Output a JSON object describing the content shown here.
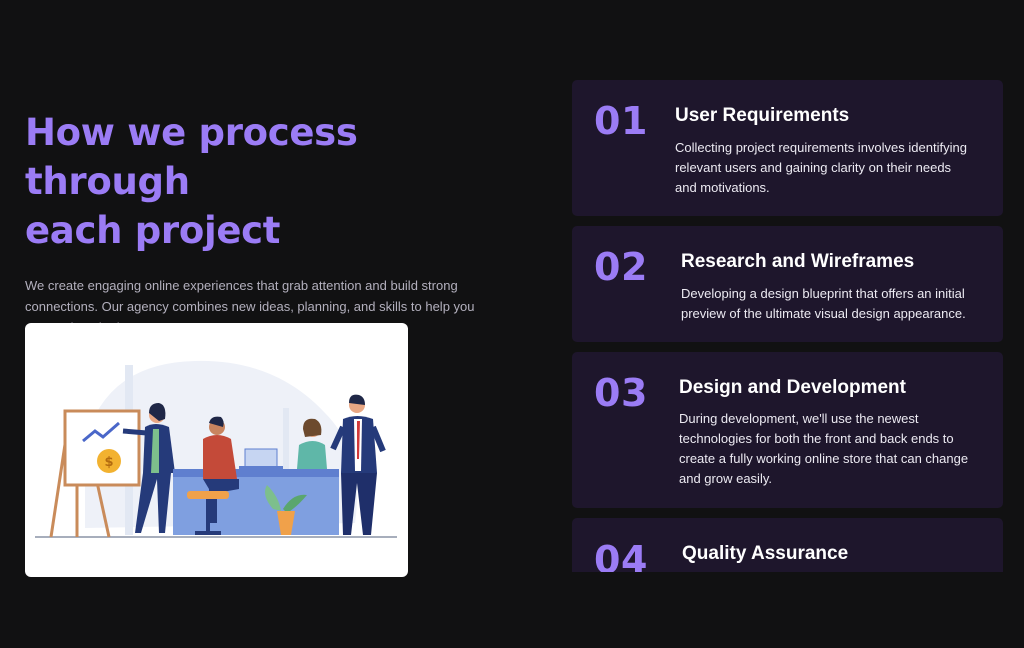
{
  "intro": {
    "heading_line1": "How we process through",
    "heading_line2": "each project",
    "description": "We create engaging online experiences that grab attention and build strong connections. Our agency combines new ideas, planning, and skills to help you succeed on the internet."
  },
  "illustration": {
    "icon": "team-meeting-illustration",
    "colors": {
      "accent": "#9b7cf5",
      "card_bg": "#1e162c",
      "page_bg": "#111112"
    }
  },
  "steps": [
    {
      "number": "01",
      "title": "User Requirements",
      "description": "Collecting project requirements involves identifying relevant users and gaining clarity on their needs and motivations."
    },
    {
      "number": "02",
      "title": "Research and Wireframes",
      "description": "Developing a design blueprint that offers an initial preview of the ultimate visual design appearance."
    },
    {
      "number": "03",
      "title": "Design and Development",
      "description": "During development, we'll use the newest technologies for both the front and back ends to create a fully working online store that can change and grow easily."
    },
    {
      "number": "04",
      "title": "Quality Assurance",
      "description": ""
    }
  ]
}
